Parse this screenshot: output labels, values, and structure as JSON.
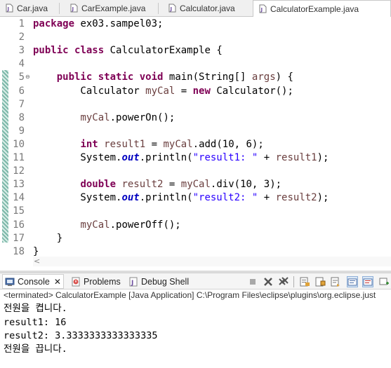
{
  "editor_tabs": [
    {
      "label": "Car.java",
      "active": false
    },
    {
      "label": "CarExample.java",
      "active": false
    },
    {
      "label": "Calculator.java",
      "active": false
    },
    {
      "label": "CalculatorExample.java",
      "active": true
    }
  ],
  "code_lines": [
    {
      "num": "1",
      "tokens": [
        {
          "t": "package",
          "c": "kw"
        },
        {
          "t": " ex03.sampel03;"
        }
      ]
    },
    {
      "num": "2",
      "tokens": []
    },
    {
      "num": "3",
      "tokens": [
        {
          "t": "public",
          "c": "kw"
        },
        {
          "t": " "
        },
        {
          "t": "class",
          "c": "kw"
        },
        {
          "t": " CalculatorExample {"
        }
      ]
    },
    {
      "num": "4",
      "tokens": []
    },
    {
      "num": "5",
      "fold": "⊖",
      "tokens": [
        {
          "t": "    "
        },
        {
          "t": "public",
          "c": "kw"
        },
        {
          "t": " "
        },
        {
          "t": "static",
          "c": "kw"
        },
        {
          "t": " "
        },
        {
          "t": "void",
          "c": "kw"
        },
        {
          "t": " main(String[] "
        },
        {
          "t": "args",
          "c": "lv"
        },
        {
          "t": ") {"
        }
      ]
    },
    {
      "num": "6",
      "tokens": [
        {
          "t": "        Calculator "
        },
        {
          "t": "myCal",
          "c": "lv"
        },
        {
          "t": " = "
        },
        {
          "t": "new",
          "c": "kw"
        },
        {
          "t": " Calculator();"
        }
      ]
    },
    {
      "num": "7",
      "tokens": []
    },
    {
      "num": "8",
      "tokens": [
        {
          "t": "        "
        },
        {
          "t": "myCal",
          "c": "lv"
        },
        {
          "t": ".powerOn();"
        }
      ]
    },
    {
      "num": "9",
      "tokens": []
    },
    {
      "num": "10",
      "tokens": [
        {
          "t": "        "
        },
        {
          "t": "int",
          "c": "kw"
        },
        {
          "t": " "
        },
        {
          "t": "result1",
          "c": "lv"
        },
        {
          "t": " = "
        },
        {
          "t": "myCal",
          "c": "lv"
        },
        {
          "t": ".add(10, 6);"
        }
      ]
    },
    {
      "num": "11",
      "tokens": [
        {
          "t": "        System."
        },
        {
          "t": "out",
          "c": "fld"
        },
        {
          "t": ".println("
        },
        {
          "t": "\"result1: \"",
          "c": "str"
        },
        {
          "t": " + "
        },
        {
          "t": "result1",
          "c": "lv"
        },
        {
          "t": ");"
        }
      ]
    },
    {
      "num": "12",
      "tokens": []
    },
    {
      "num": "13",
      "tokens": [
        {
          "t": "        "
        },
        {
          "t": "double",
          "c": "kw"
        },
        {
          "t": " "
        },
        {
          "t": "result2",
          "c": "lv"
        },
        {
          "t": " = "
        },
        {
          "t": "myCal",
          "c": "lv"
        },
        {
          "t": ".div(10, 3);"
        }
      ]
    },
    {
      "num": "14",
      "tokens": [
        {
          "t": "        System."
        },
        {
          "t": "out",
          "c": "fld"
        },
        {
          "t": ".println("
        },
        {
          "t": "\"result2: \"",
          "c": "str"
        },
        {
          "t": " + "
        },
        {
          "t": "result2",
          "c": "lv"
        },
        {
          "t": ");"
        }
      ]
    },
    {
      "num": "15",
      "tokens": []
    },
    {
      "num": "16",
      "tokens": [
        {
          "t": "        "
        },
        {
          "t": "myCal",
          "c": "lv"
        },
        {
          "t": ".powerOff();"
        }
      ]
    },
    {
      "num": "17",
      "tokens": [
        {
          "t": "    }"
        }
      ]
    },
    {
      "num": "18",
      "tokens": [
        {
          "t": "}"
        }
      ]
    }
  ],
  "console_tabs": {
    "console": "Console",
    "close": "✕",
    "problems": "Problems",
    "debug_shell": "Debug Shell"
  },
  "terminated_line": "<terminated> CalculatorExample [Java Application] C:\\Program Files\\eclipse\\plugins\\org.eclipse.just",
  "output_lines": [
    "전원을 켭니다.",
    "result1: 16",
    "result2: 3.3333333333333335",
    "전원을 끕니다."
  ],
  "colors": {
    "keyword": "#7f0055",
    "string": "#2a00ff",
    "static_field": "#0000c0",
    "local_var": "#6a3e3e",
    "line_number": "#787878"
  }
}
